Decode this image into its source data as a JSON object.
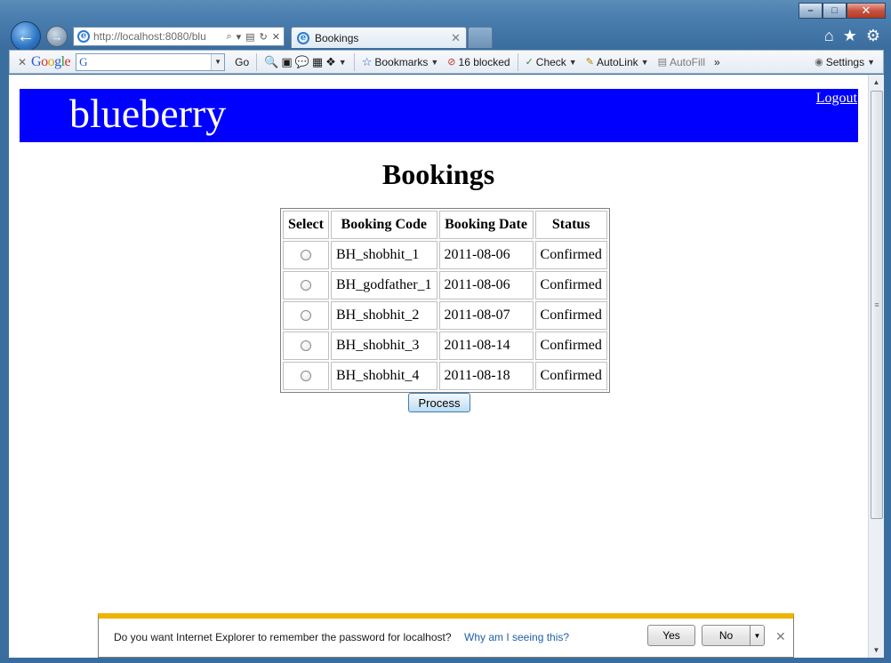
{
  "browser": {
    "address_url": "http://localhost:8080/blu",
    "tab_title": "Bookings",
    "window_controls": {
      "minimize": "–",
      "maximize": "□",
      "close": "✕"
    }
  },
  "toolbar": {
    "google_logo": "Google",
    "search_icon_glyph": "G",
    "go_label": "Go",
    "bookmarks_label": "Bookmarks",
    "blocked_label": "16 blocked",
    "check_label": "Check",
    "autolink_label": "AutoLink",
    "autofill_label": "AutoFill",
    "settings_label": "Settings",
    "more_glyph": "»"
  },
  "header": {
    "brand": "blueberry",
    "logout_label": "Logout",
    "banner_color": "#0000ff"
  },
  "page": {
    "title": "Bookings",
    "table": {
      "headers": [
        "Select",
        "Booking Code",
        "Booking Date",
        "Status"
      ],
      "rows": [
        {
          "code": "BH_shobhit_1",
          "date": "2011-08-06",
          "status": "Confirmed"
        },
        {
          "code": "BH_godfather_1",
          "date": "2011-08-06",
          "status": "Confirmed"
        },
        {
          "code": "BH_shobhit_2",
          "date": "2011-08-07",
          "status": "Confirmed"
        },
        {
          "code": "BH_shobhit_3",
          "date": "2011-08-14",
          "status": "Confirmed"
        },
        {
          "code": "BH_shobhit_4",
          "date": "2011-08-18",
          "status": "Confirmed"
        }
      ]
    },
    "process_label": "Process"
  },
  "notification": {
    "message": "Do you want Internet Explorer to remember the password for localhost?",
    "link": "Why am I seeing this?",
    "yes_label": "Yes",
    "no_label": "No",
    "accent_color": "#f0b400"
  }
}
